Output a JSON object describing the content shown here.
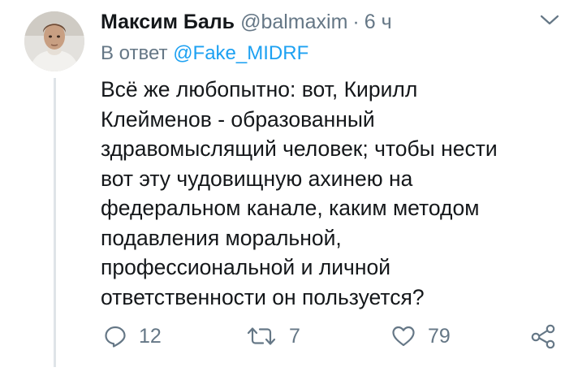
{
  "tweet": {
    "author_name": "Максим Баль",
    "handle": "@balmaxim",
    "separator": "·",
    "time": "6 ч",
    "reply_prefix": "В ответ",
    "reply_mention": "@Fake_MIDRF",
    "body_lines": [
      "Всё же любопытно: вот, Кирилл",
      "Клейменов - образованный",
      "здравомыслящий человек; чтобы нести",
      "вот эту чудовищную ахинею на",
      "федеральном канале, каким методом",
      "подавления моральной,",
      "профессиональной и личной",
      "ответственности он пользуется?"
    ]
  },
  "actions": {
    "reply": {
      "icon": "reply-icon",
      "count": "12"
    },
    "retweet": {
      "icon": "retweet-icon",
      "count": "7"
    },
    "like": {
      "icon": "heart-icon",
      "count": "79"
    },
    "share": {
      "icon": "share-icon"
    }
  },
  "colors": {
    "text": "#14171a",
    "secondary": "#657786",
    "link": "#1da1f2",
    "thread_line": "#dfe4e8"
  }
}
